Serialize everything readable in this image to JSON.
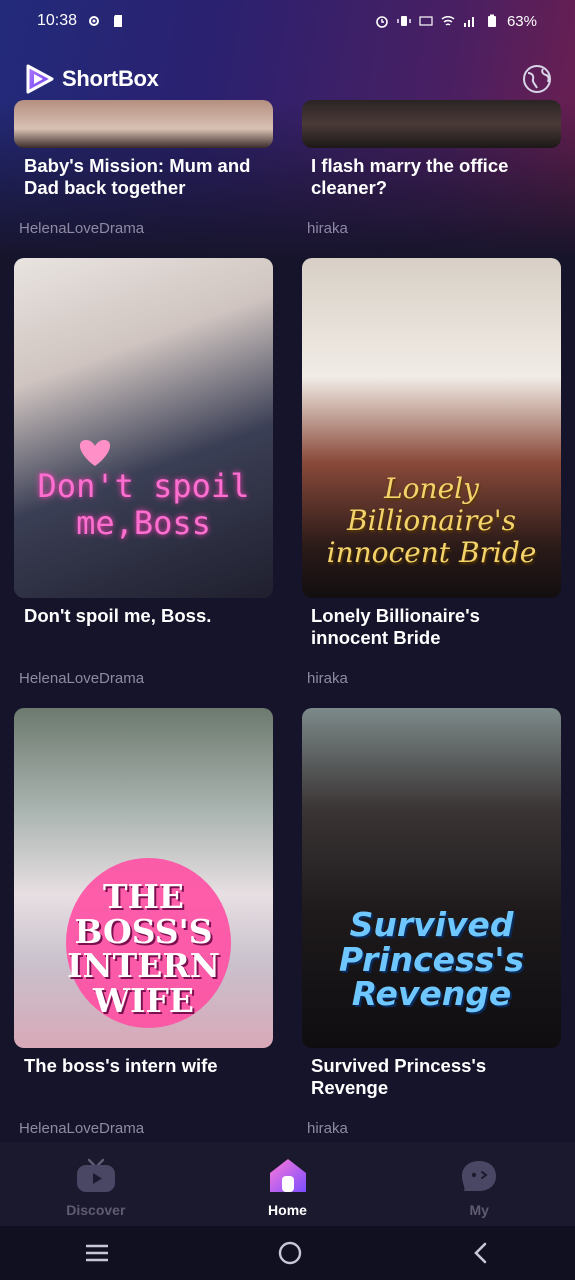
{
  "status": {
    "time": "10:38",
    "battery": "63%"
  },
  "header": {
    "app_name": "ShortBox"
  },
  "dramas": [
    {
      "title": "Baby's Mission: Mum and Dad back together",
      "author": "HelenaLoveDrama"
    },
    {
      "title": "I flash marry the office cleaner?",
      "author": "hiraka"
    },
    {
      "title": "Don't spoil me, Boss.",
      "author": "HelenaLoveDrama",
      "poster_text": "Don't spoil me,Boss"
    },
    {
      "title": "Lonely Billionaire's innocent Bride",
      "author": "hiraka",
      "poster_text": "Lonely Billionaire's innocent Bride"
    },
    {
      "title": "The boss's intern wife",
      "author": "HelenaLoveDrama",
      "poster_text": "THE BOSS'S INTERN WIFE"
    },
    {
      "title": "Survived Princess's Revenge",
      "author": "hiraka",
      "poster_text": "Survived Princess's Revenge"
    },
    {
      "author": "HelenaLoveDrama"
    },
    {
      "author": "hiraka"
    }
  ],
  "nav": {
    "discover": "Discover",
    "home": "Home",
    "my": "My"
  },
  "colors": {
    "accent": "#7b4dff",
    "inactive": "#5f5b72",
    "background": "#16142a"
  }
}
